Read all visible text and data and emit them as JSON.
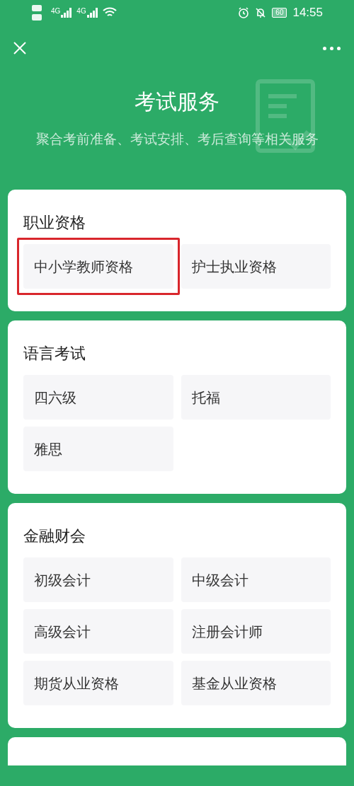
{
  "status_bar": {
    "network_labels": [
      "4G",
      "4G"
    ],
    "battery": "60",
    "time": "14:55"
  },
  "header": {
    "title": "考试服务",
    "subtitle": "聚合考前准备、考试安排、考后查询等相关服务"
  },
  "sections": [
    {
      "title": "职业资格",
      "items": [
        {
          "label": "中小学教师资格",
          "highlighted": true
        },
        {
          "label": "护士执业资格",
          "highlighted": false
        }
      ]
    },
    {
      "title": "语言考试",
      "items": [
        {
          "label": "四六级",
          "highlighted": false
        },
        {
          "label": "托福",
          "highlighted": false
        },
        {
          "label": "雅思",
          "highlighted": false
        }
      ]
    },
    {
      "title": "金融财会",
      "items": [
        {
          "label": "初级会计",
          "highlighted": false
        },
        {
          "label": "中级会计",
          "highlighted": false
        },
        {
          "label": "高级会计",
          "highlighted": false
        },
        {
          "label": "注册会计师",
          "highlighted": false
        },
        {
          "label": "期货从业资格",
          "highlighted": false
        },
        {
          "label": "基金从业资格",
          "highlighted": false
        }
      ]
    }
  ]
}
